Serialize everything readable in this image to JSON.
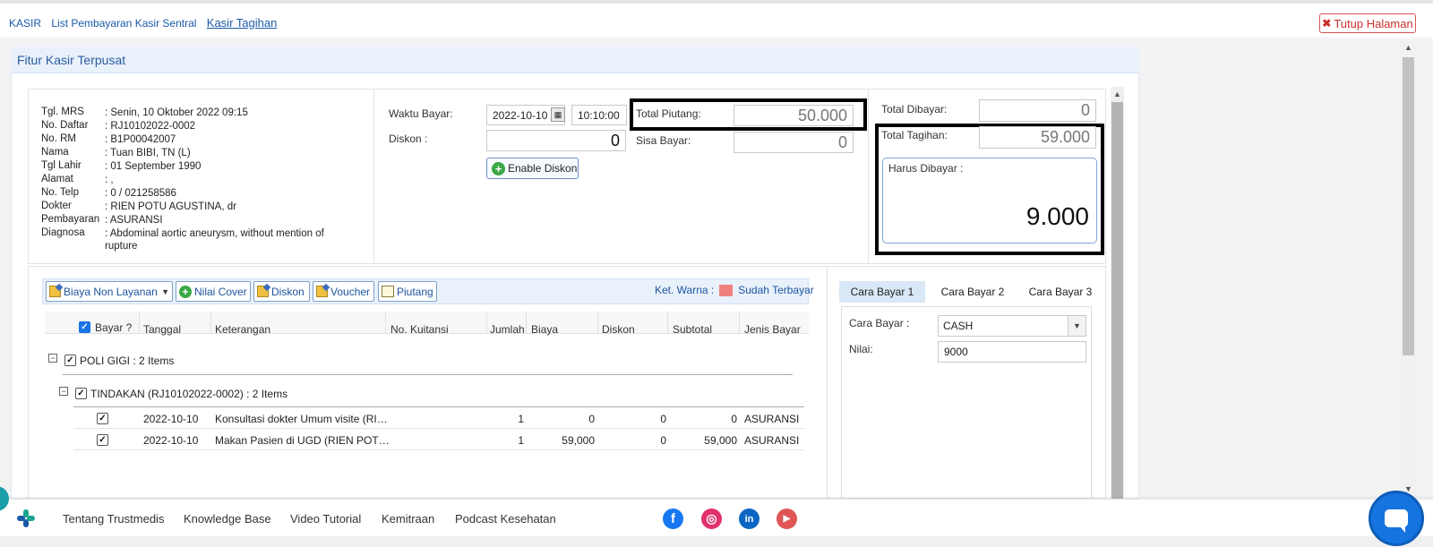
{
  "breadcrumb": {
    "items": [
      "KASIR",
      "List Pembayaran Kasir Sentral"
    ],
    "active": "Kasir Tagihan"
  },
  "close_button": {
    "label": "Tutup Halaman"
  },
  "panel": {
    "title": "Fitur Kasir Terpusat"
  },
  "patient": {
    "rows": [
      {
        "k": "Tgl. MRS",
        "v": ": Senin, 10 Oktober 2022 09:15"
      },
      {
        "k": "No. Daftar",
        "v": ": RJ10102022-0002"
      },
      {
        "k": "No. RM",
        "v": ": B1P00042007"
      },
      {
        "k": "Nama",
        "v": ": Tuan BIBI, TN (L)"
      },
      {
        "k": "Tgl Lahir",
        "v": ": 01 September 1990"
      },
      {
        "k": "Alamat",
        "v": ": ,"
      },
      {
        "k": "No. Telp",
        "v": ": 0 / 021258586"
      },
      {
        "k": "Dokter",
        "v": ": RIEN POTU AGUSTINA, dr"
      },
      {
        "k": "Pembayaran",
        "v": ": ASURANSI"
      },
      {
        "k": "Diagnosa",
        "v": ": Abdominal aortic aneurysm, without mention of rupture"
      }
    ]
  },
  "payment": {
    "waktu_label": "Waktu Bayar:",
    "date": "2022-10-10",
    "time": "10:10:00",
    "diskon_label": "Diskon :",
    "diskon_value": "0",
    "enable_diskon": "Enable Diskon",
    "total_piutang_label": "Total Piutang:",
    "total_piutang_value": "50.000",
    "sisa_bayar_label": "Sisa Bayar:",
    "sisa_bayar_value": "0"
  },
  "totals": {
    "dibayar_label": "Total Dibayar:",
    "dibayar_value": "0",
    "tagihan_label": "Total Tagihan:",
    "tagihan_value": "59.000",
    "harus_label": "Harus Dibayar :",
    "harus_value": "9.000"
  },
  "toolbar": {
    "biaya_non_layanan": "Biaya Non Layanan",
    "nilai_cover": "Nilai Cover",
    "diskon": "Diskon",
    "voucher": "Voucher",
    "piutang": "Piutang",
    "ket_warna": "Ket. Warna :",
    "sudah_terbayar": "Sudah Terbayar"
  },
  "table": {
    "headers": [
      "Bayar ?",
      "Tanggal",
      "Keterangan",
      "No. Kuitansi",
      "Jumlah",
      "Biaya",
      "Diskon",
      "Subtotal",
      "Jenis Bayar"
    ],
    "group1": "POLI GIGI : 2 Items",
    "group2": "TINDAKAN (RJ10102022-0002) : 2 Items",
    "rows": [
      {
        "tanggal": "2022-10-10",
        "keterangan": "Konsultasi dokter Umum visite (RI…",
        "jumlah": "1",
        "biaya": "0",
        "diskon": "0",
        "subtotal": "0",
        "jenis": "ASURANSI"
      },
      {
        "tanggal": "2022-10-10",
        "keterangan": "Makan Pasien di UGD (RIEN POT…",
        "jumlah": "1",
        "biaya": "59,000",
        "diskon": "0",
        "subtotal": "59,000",
        "jenis": "ASURANSI"
      }
    ]
  },
  "cara_bayar": {
    "tabs": [
      "Cara Bayar 1",
      "Cara Bayar 2",
      "Cara Bayar 3"
    ],
    "cara_label": "Cara Bayar :",
    "cara_value": "CASH",
    "nilai_label": "Nilai:",
    "nilai_value": "9000"
  },
  "footer": {
    "links": [
      "Tentang Trustmedis",
      "Knowledge Base",
      "Video Tutorial",
      "Kemitraan",
      "Podcast Kesehatan"
    ],
    "social": {
      "facebook": "f",
      "instagram": "◎",
      "linkedin": "in",
      "youtube": "▶"
    }
  },
  "colors": {
    "accent": "#1a5aa8",
    "highlight_border": "#000000",
    "paid_swatch": "#f08080",
    "chat": "#1574e0"
  }
}
